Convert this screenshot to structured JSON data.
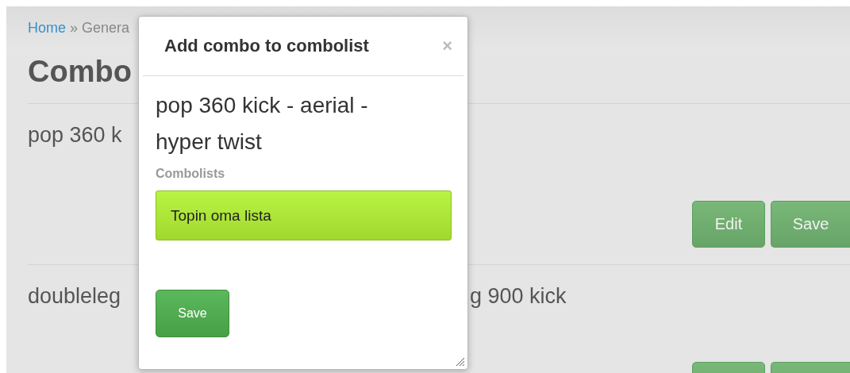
{
  "breadcrumb": {
    "home": "Home",
    "separator": "»",
    "current": "Genera"
  },
  "heading": "Combo",
  "rows": [
    {
      "text_left": "pop 360 k",
      "buttons": [
        {
          "label": "Edit"
        },
        {
          "label": "Save"
        }
      ]
    },
    {
      "text_left": "doubleleg",
      "text_right": "g 900 kick",
      "buttons": [
        {
          "kind": "unlabeled"
        },
        {
          "kind": "unlabeled"
        }
      ]
    }
  ],
  "modal": {
    "title": "Add combo to combolist",
    "close": "×",
    "combo_name": "pop 360 kick - aerial - hyper twist",
    "section_label": "Combolists",
    "combolists": [
      {
        "name": "Topin oma lista",
        "selected": true
      }
    ],
    "save": "Save"
  }
}
